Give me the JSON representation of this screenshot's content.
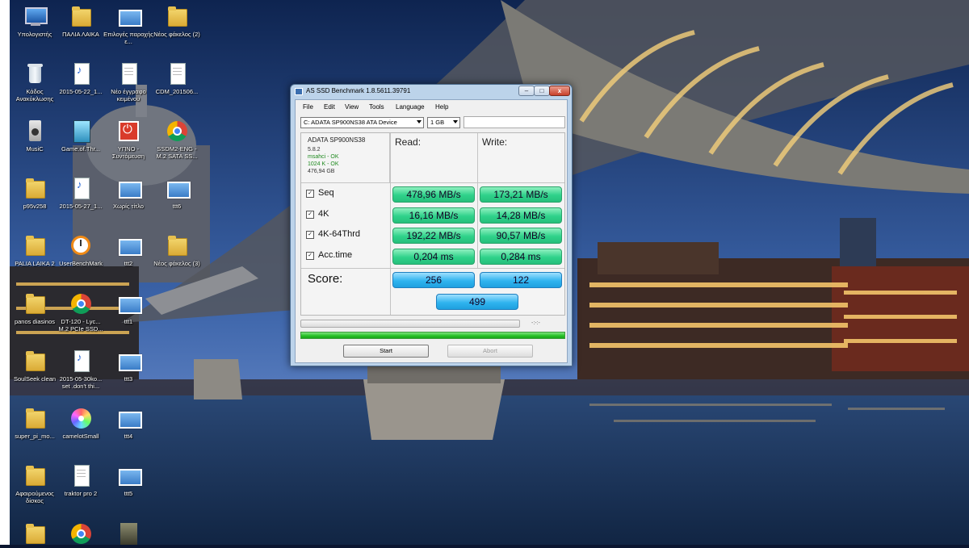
{
  "desktop": {
    "icons": [
      {
        "label": "Υπολογιστής",
        "icon": "computer-icon"
      },
      {
        "label": "ΠΑΛΙΑ ΛΑΙΚΑ",
        "icon": "folder-icon"
      },
      {
        "label": "Επιλογές παροχής ε...",
        "icon": "power-options-icon"
      },
      {
        "label": "Νέος φάκελος (2)",
        "icon": "folder-icon"
      },
      {
        "label": "Κάδος Ανακύκλωσης",
        "icon": "recycle-bin-icon"
      },
      {
        "label": "2015-05-22_1...",
        "icon": "wav-file-icon"
      },
      {
        "label": "Νέο έγγραφο κειμένου",
        "icon": "text-document-icon"
      },
      {
        "label": "CDM_201506...",
        "icon": "text-document-icon"
      },
      {
        "label": "MusiC",
        "icon": "speaker-icon"
      },
      {
        "label": "Game.of.Thr...",
        "icon": "game-file-icon"
      },
      {
        "label": "ΥΠΝΟ - Συντόμευση",
        "icon": "power-shortcut-icon"
      },
      {
        "label": "SSDM2-ENG - M.2 SATA SS...",
        "icon": "chrome-icon"
      },
      {
        "label": "p95v258",
        "icon": "folder-icon"
      },
      {
        "label": "2015-05-27_1...",
        "icon": "wav-file-icon"
      },
      {
        "label": "Χωρίς τίτλο",
        "icon": "image-file-icon"
      },
      {
        "label": "ttt6",
        "icon": "image-file-icon"
      },
      {
        "label": "PALIA LAIKA 2",
        "icon": "folder-icon"
      },
      {
        "label": "UserBenchMark",
        "icon": "clock-app-icon"
      },
      {
        "label": "ttt2",
        "icon": "image-file-icon"
      },
      {
        "label": "Νέος φάκελος (3)",
        "icon": "folder-icon"
      },
      {
        "label": "panos diasinos",
        "icon": "folder-icon"
      },
      {
        "label": "DT-120 - Lyc... M.2 PCIe SSD...",
        "icon": "chrome-icon"
      },
      {
        "label": "ttt1",
        "icon": "image-file-icon"
      },
      {
        "label": "SoulSeek clean",
        "icon": "folder-icon"
      },
      {
        "label": "2015-05-30ko... set .don't thi...",
        "icon": "wav-file-icon"
      },
      {
        "label": "ttt3",
        "icon": "image-file-icon"
      },
      {
        "label": "super_pi_mo...",
        "icon": "folder-icon"
      },
      {
        "label": "camelotSmall",
        "icon": "disc-app-icon"
      },
      {
        "label": "ttt4",
        "icon": "image-file-icon"
      },
      {
        "label": "Αφαιρούμενος δίσκος",
        "icon": "folder-icon"
      },
      {
        "label": "traktor pro 2",
        "icon": "text-document-icon"
      },
      {
        "label": "ttt5",
        "icon": "image-file-icon"
      },
      {
        "label": "",
        "icon": "folder-icon"
      },
      {
        "label": "",
        "icon": "chrome-icon"
      },
      {
        "label": "",
        "icon": "photo-file-icon"
      }
    ]
  },
  "window": {
    "title": "AS SSD Benchmark 1.8.5611.39791",
    "controls": {
      "minimize": "–",
      "maximize": "□",
      "close": "x"
    },
    "menu": [
      "File",
      "Edit",
      "View",
      "Tools",
      "Language",
      "Help"
    ],
    "drive_select": "C: ADATA SP900NS38 ATA Device",
    "size_select": "1 GB",
    "info": {
      "drive_name": "ADATA SP900NS38",
      "firmware": "5.8.2",
      "driver_status": "msahci - OK",
      "alignment_status": "1024 K - OK",
      "capacity": "476,94 GB"
    },
    "columns": {
      "read": "Read:",
      "write": "Write:"
    },
    "rows": [
      {
        "label": "Seq",
        "checked": true,
        "read": "478,96 MB/s",
        "write": "173,21 MB/s"
      },
      {
        "label": "4K",
        "checked": true,
        "read": "16,16 MB/s",
        "write": "14,28 MB/s"
      },
      {
        "label": "4K-64Thrd",
        "checked": true,
        "read": "192,22 MB/s",
        "write": "90,57 MB/s"
      },
      {
        "label": "Acc.time",
        "checked": true,
        "read": "0,204 ms",
        "write": "0,284 ms"
      }
    ],
    "score": {
      "label": "Score:",
      "read": "256",
      "write": "122",
      "total": "499"
    },
    "progress": {
      "time": "-:-:-",
      "completion": 1.0
    },
    "buttons": {
      "start": "Start",
      "abort": "Abort"
    },
    "colors": {
      "result_green": "#2fd28a",
      "score_blue": "#30b4ef",
      "progress_green": "#24c024"
    }
  }
}
